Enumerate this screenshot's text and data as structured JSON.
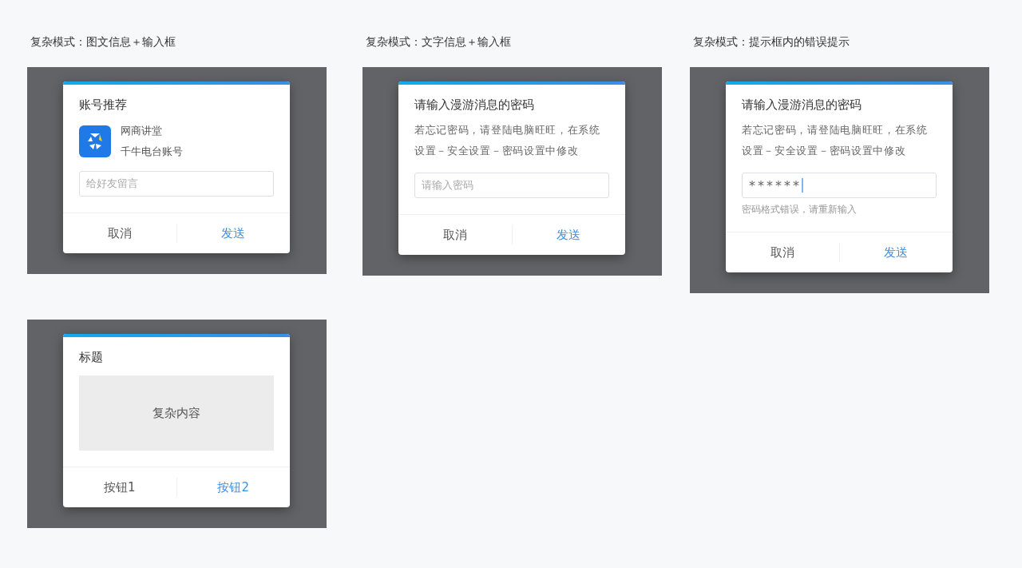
{
  "sections": [
    {
      "heading": "复杂模式：图文信息＋输入框",
      "dialog": {
        "title": "账号推荐",
        "body": [
          {
            "kind": "account",
            "name": "网商讲堂",
            "subtitle": "千牛电台账号"
          },
          {
            "kind": "input",
            "placeholder": "给好友留言"
          }
        ],
        "buttons": [
          {
            "label": "取消",
            "primary": false
          },
          {
            "label": "发送",
            "primary": true
          }
        ]
      }
    },
    {
      "heading": "复杂模式：文字信息＋输入框",
      "dialog": {
        "title": "请输入漫游消息的密码",
        "body": [
          {
            "kind": "text",
            "text": "若忘记密码，请登陆电脑旺旺，在系统设置－安全设置－密码设置中修改"
          },
          {
            "kind": "input",
            "placeholder": "请输入密码"
          }
        ],
        "buttons": [
          {
            "label": "取消",
            "primary": false
          },
          {
            "label": "发送",
            "primary": true
          }
        ]
      }
    },
    {
      "heading": "复杂模式：提示框内的错误提示",
      "dialog": {
        "title": "请输入漫游消息的密码",
        "body": [
          {
            "kind": "text",
            "text": "若忘记密码，请登陆电脑旺旺，在系统设置－安全设置－密码设置中修改"
          },
          {
            "kind": "input",
            "value": "******",
            "focused": true
          },
          {
            "kind": "error",
            "text": "密码格式错误，请重新输入"
          }
        ],
        "buttons": [
          {
            "label": "取消",
            "primary": false
          },
          {
            "label": "发送",
            "primary": true
          }
        ]
      }
    },
    {
      "dialog": {
        "title": "标题",
        "body": [
          {
            "kind": "block",
            "text": "复杂内容"
          }
        ],
        "buttons": [
          {
            "label": "按钮1",
            "primary": false
          },
          {
            "label": "按钮2",
            "primary": true
          }
        ]
      }
    }
  ]
}
